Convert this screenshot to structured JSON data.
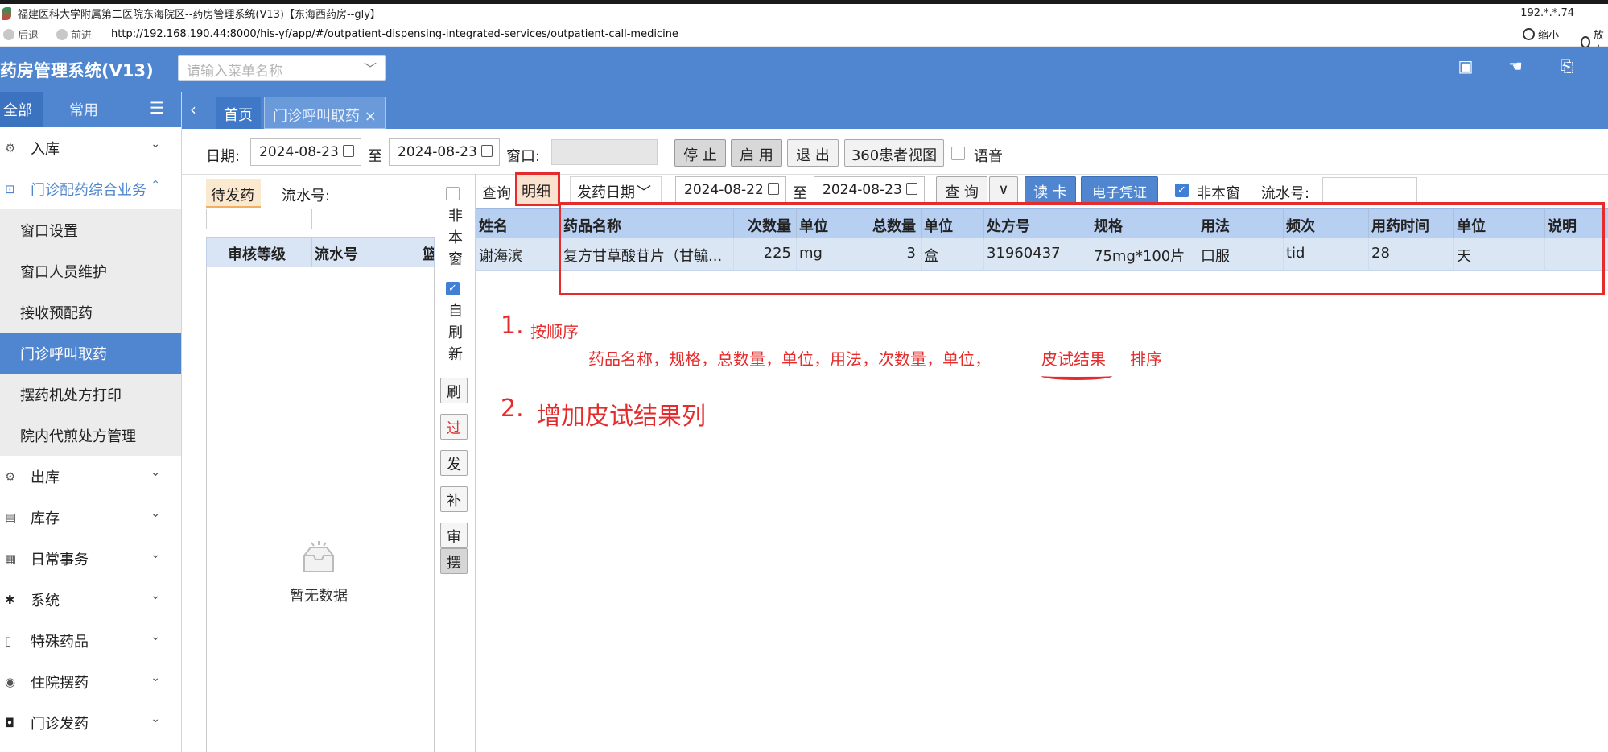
{
  "window": {
    "title": "福建医科大学附属第二医院东海院区--药房管理系统(V13)【东海西药房--gly】",
    "ip": "192.*.*.74",
    "back": "后退",
    "forward": "前进",
    "url": "http://192.168.190.44:8000/his-yf/app/#/outpatient-dispensing-integrated-services/outpatient-call-medicine",
    "zoom_out": "缩小",
    "zoom_in": "放大"
  },
  "header": {
    "title": "药房管理系统(V13)",
    "search_placeholder": "请输入菜单名称"
  },
  "sidebar": {
    "tabs": [
      "全部",
      "常用"
    ],
    "menu": [
      {
        "label": "入库",
        "icon": "gear-icon",
        "expanded": false
      },
      {
        "label": "门诊配药综合业务",
        "icon": "box-icon",
        "expanded": true,
        "children": [
          "窗口设置",
          "窗口人员维护",
          "接收预配药",
          "门诊呼叫取药",
          "摆药机处方打印",
          "院内代煎处方管理"
        ],
        "active_child": "门诊呼叫取药"
      },
      {
        "label": "出库",
        "icon": "gear-icon",
        "expanded": false
      },
      {
        "label": "库存",
        "icon": "stock-icon",
        "expanded": false
      },
      {
        "label": "日常事务",
        "icon": "calendar-icon",
        "expanded": false
      },
      {
        "label": "系统",
        "icon": "cog-icon",
        "expanded": false
      },
      {
        "label": "特殊药品",
        "icon": "medicine-icon",
        "expanded": false
      },
      {
        "label": "住院摆药",
        "icon": "target-icon",
        "expanded": false
      },
      {
        "label": "门诊发药",
        "icon": "lock-icon",
        "expanded": false
      }
    ]
  },
  "tabs": {
    "home": "首页",
    "current": "门诊呼叫取药",
    "close": "×"
  },
  "toolbar1": {
    "date_label": "日期:",
    "date_from": "2024-08-23",
    "to": "至",
    "date_to": "2024-08-23",
    "window_label": "窗口:",
    "stop": "停 止",
    "enable": "启 用",
    "exit": "退 出",
    "view360": "360患者视图",
    "voice": "语音"
  },
  "leftpanel": {
    "tab_pending": "待发药",
    "serial_label": "流水号:",
    "col_review": "审核等级",
    "col_serial": "流水号",
    "col_extra": "篮",
    "empty": "暂无数据",
    "not_this_window": "非本窗",
    "auto_refresh": "自刷新",
    "side_buttons": [
      "刷",
      "过",
      "发",
      "补",
      "审",
      "摆"
    ]
  },
  "toolbar2": {
    "query": "查询",
    "detail": "明细",
    "date_type": "发药日期",
    "date_from": "2024-08-22",
    "to": "至",
    "date_to": "2024-08-23",
    "search_btn": "查 询",
    "read_card": "读 卡",
    "e_voucher": "电子凭证",
    "not_this_window": "非本窗",
    "serial_label": "流水号:"
  },
  "table": {
    "headers": [
      "姓名",
      "药品名称",
      "次数量",
      "单位",
      "总数量",
      "单位",
      "处方号",
      "规格",
      "用法",
      "频次",
      "用药时间",
      "单位",
      "说明"
    ],
    "rows": [
      [
        "谢海滨",
        "复方甘草酸苷片（甘毓...",
        "225",
        "mg",
        "3",
        "盒",
        "31960437",
        "75mg*100片",
        "口服",
        "tid",
        "28",
        "天",
        ""
      ]
    ]
  },
  "annotations": {
    "n1": "1.",
    "n1_text": "按顺序",
    "order": "药品名称，规格，总数量，单位，用法，次数量，单位，",
    "skin_test": "皮试结果",
    "sort": "排序",
    "n2": "2.",
    "n2_text": "增加皮试结果列"
  },
  "colors": {
    "header_blue": "#4f86cf",
    "annotation_red": "#e52b2b",
    "row_blue": "#dbe6f5"
  }
}
